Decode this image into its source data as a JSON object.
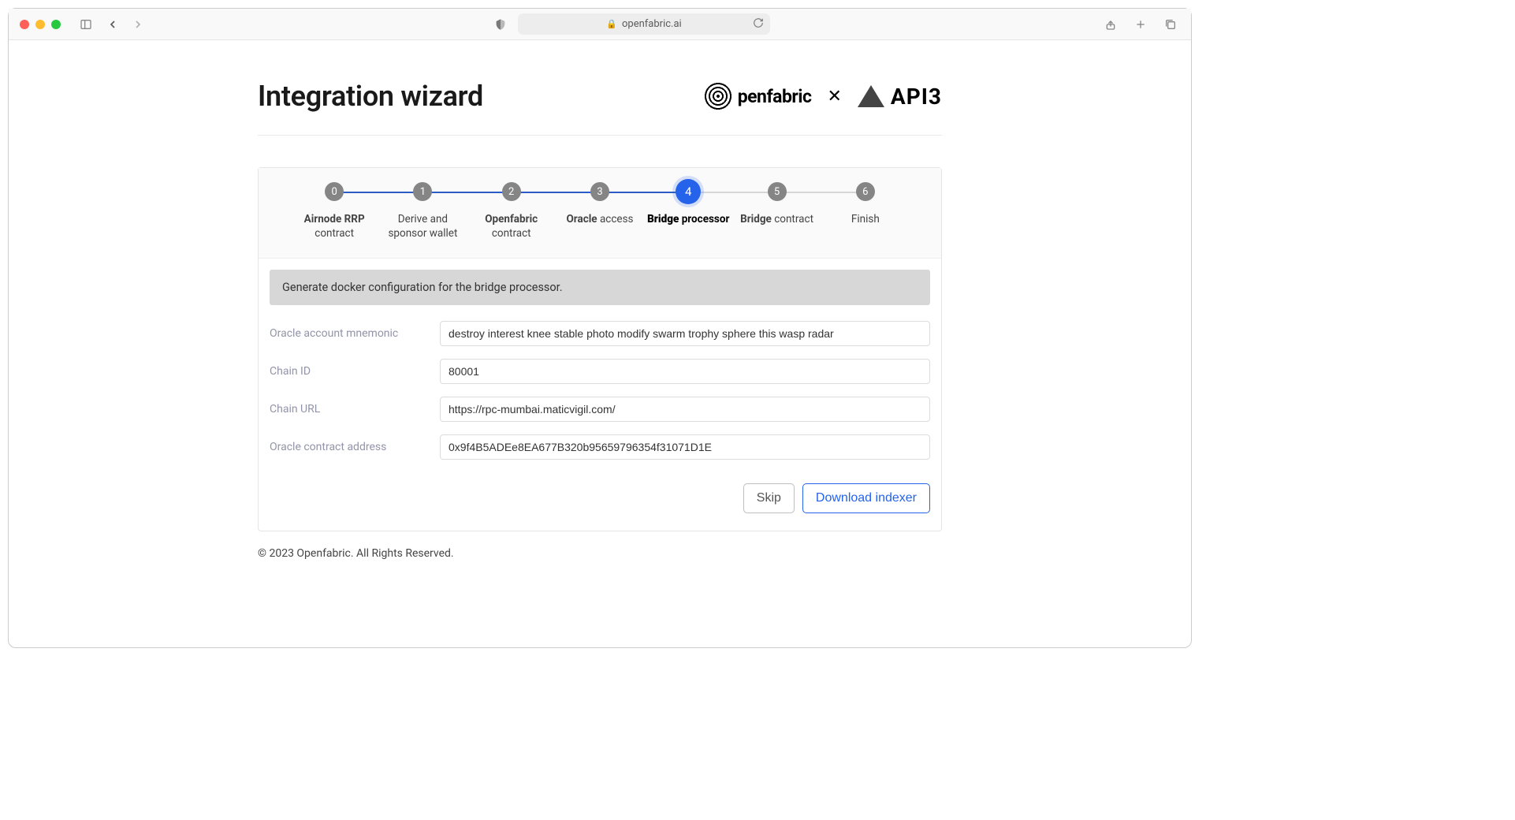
{
  "browser": {
    "url": "openfabric.ai"
  },
  "header": {
    "title": "Integration wizard",
    "logo1": "penfabric",
    "separator": "✕",
    "logo2": "API3"
  },
  "stepper": {
    "steps": [
      {
        "num": "0",
        "label_bold": "Airnode RRP",
        "label_rest": " contract"
      },
      {
        "num": "1",
        "label_bold": "",
        "label_rest": "Derive and sponsor wallet"
      },
      {
        "num": "2",
        "label_bold": "Openfabric",
        "label_rest": " contract"
      },
      {
        "num": "3",
        "label_bold": "Oracle",
        "label_rest": " access"
      },
      {
        "num": "4",
        "label_bold": "Bridge",
        "label_rest": " processor"
      },
      {
        "num": "5",
        "label_bold": "Bridge",
        "label_rest": " contract"
      },
      {
        "num": "6",
        "label_bold": "",
        "label_rest": "Finish"
      }
    ],
    "active_index": 4
  },
  "banner": {
    "text": "Generate docker configuration for the bridge processor."
  },
  "form": {
    "fields": [
      {
        "label": "Oracle account mnemonic",
        "value": "destroy interest knee stable photo modify swarm trophy sphere this wasp radar"
      },
      {
        "label": "Chain ID",
        "value": "80001"
      },
      {
        "label": "Chain URL",
        "value": "https://rpc-mumbai.maticvigil.com/"
      },
      {
        "label": "Oracle contract address",
        "value": "0x9f4B5ADEe8EA677B320b95659796354f31071D1E"
      }
    ]
  },
  "buttons": {
    "skip": "Skip",
    "primary": "Download indexer"
  },
  "footer": {
    "text": "© 2023 Openfabric. All Rights Reserved."
  }
}
